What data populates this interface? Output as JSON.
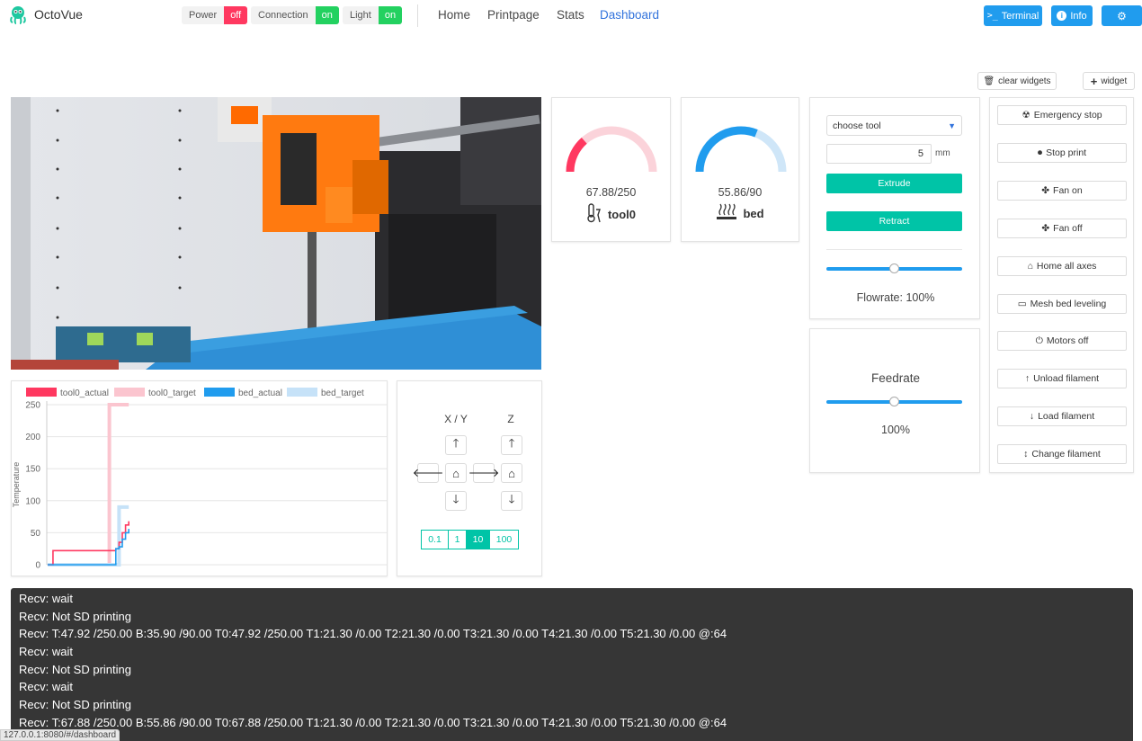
{
  "navbar": {
    "brand": "OctoVue",
    "toggles": [
      {
        "label": "Power",
        "state": "off"
      },
      {
        "label": "Connection",
        "state": "on"
      },
      {
        "label": "Light",
        "state": "on"
      }
    ],
    "links": [
      "Home",
      "Printpage",
      "Stats",
      "Dashboard"
    ],
    "active_link": "Dashboard",
    "terminal_label": "Terminal",
    "info_label": "Info",
    "settings_icon": "gear-icon"
  },
  "widget_controls": {
    "clear_label": "clear widgets",
    "add_label": "widget"
  },
  "gauges": [
    {
      "value_text": "67.88/250",
      "name": "tool0",
      "fraction": 0.2715,
      "color": "#ff3860",
      "track": "#fbd3da"
    },
    {
      "value_text": "55.86/90",
      "name": "bed",
      "fraction": 0.6207,
      "color": "#209cee",
      "track": "#cfe6f8"
    }
  ],
  "extruder": {
    "tool_select": "choose tool",
    "amount": "5",
    "unit": "mm",
    "extrude_label": "Extrude",
    "retract_label": "Retract",
    "flowrate_label": "Flowrate: 100%",
    "flowrate_value": 100
  },
  "feedrate": {
    "label": "Feedrate",
    "value_text": "100%",
    "value": 100
  },
  "commands": [
    {
      "label": "Emergency stop",
      "icon": "radiation-icon"
    },
    {
      "label": "Stop print",
      "icon": "stop-circle-icon"
    },
    {
      "label": "Fan on",
      "icon": "fan-icon"
    },
    {
      "label": "Fan off",
      "icon": "fan-icon"
    },
    {
      "label": "Home all axes",
      "icon": "home-icon"
    },
    {
      "label": "Mesh bed leveling",
      "icon": "bed-icon"
    },
    {
      "label": "Motors off",
      "icon": "power-icon"
    },
    {
      "label": "Unload filament",
      "icon": "arrow-up-icon"
    },
    {
      "label": "Load filament",
      "icon": "arrow-down-icon"
    },
    {
      "label": "Change filament",
      "icon": "arrows-vertical-icon"
    }
  ],
  "jog": {
    "xy_label": "X / Y",
    "z_label": "Z",
    "steps": [
      "0.1",
      "1",
      "10",
      "100"
    ],
    "selected_step": "10"
  },
  "chart_data": {
    "type": "line",
    "ylabel": "Temperature",
    "yticks": [
      0,
      50,
      100,
      150,
      200,
      250
    ],
    "ylim": [
      0,
      250
    ],
    "legend_position": "top",
    "series": [
      {
        "name": "tool0_actual",
        "color": "#ff3860",
        "values": [
          0,
          22,
          22,
          22,
          22,
          22,
          22,
          22,
          22,
          22,
          22,
          22,
          22,
          22,
          22,
          22,
          25,
          35,
          50,
          62,
          68
        ]
      },
      {
        "name": "tool0_target",
        "color": "#fbc5cf",
        "values": [
          0,
          0,
          0,
          0,
          0,
          0,
          0,
          0,
          0,
          0,
          0,
          0,
          0,
          0,
          250,
          250,
          250,
          250,
          250,
          250,
          250
        ]
      },
      {
        "name": "bed_actual",
        "color": "#209cee",
        "values": [
          0,
          0,
          0,
          0,
          0,
          0,
          0,
          0,
          0,
          0,
          0,
          0,
          0,
          0,
          0,
          0,
          25,
          28,
          40,
          50,
          56
        ]
      },
      {
        "name": "bed_target",
        "color": "#c6e2f8",
        "values": [
          0,
          0,
          0,
          0,
          0,
          0,
          0,
          0,
          0,
          0,
          0,
          0,
          0,
          0,
          0,
          0,
          0,
          90,
          90,
          90,
          90
        ]
      }
    ]
  },
  "terminal": {
    "lines": [
      "Recv: wait",
      "Recv: Not SD printing",
      "Recv: T:47.92 /250.00 B:35.90 /90.00 T0:47.92 /250.00 T1:21.30 /0.00 T2:21.30 /0.00 T3:21.30 /0.00 T4:21.30 /0.00 T5:21.30 /0.00 @:64",
      "Recv: wait",
      "Recv: Not SD printing",
      "Recv: wait",
      "Recv: Not SD printing",
      "Recv: T:67.88 /250.00 B:55.86 /90.00 T0:67.88 /250.00 T1:21.30 /0.00 T2:21.30 /0.00 T3:21.30 /0.00 T4:21.30 /0.00 T5:21.30 /0.00 @:64"
    ]
  },
  "status_url": "127.0.0.1:8080/#/dashboard"
}
